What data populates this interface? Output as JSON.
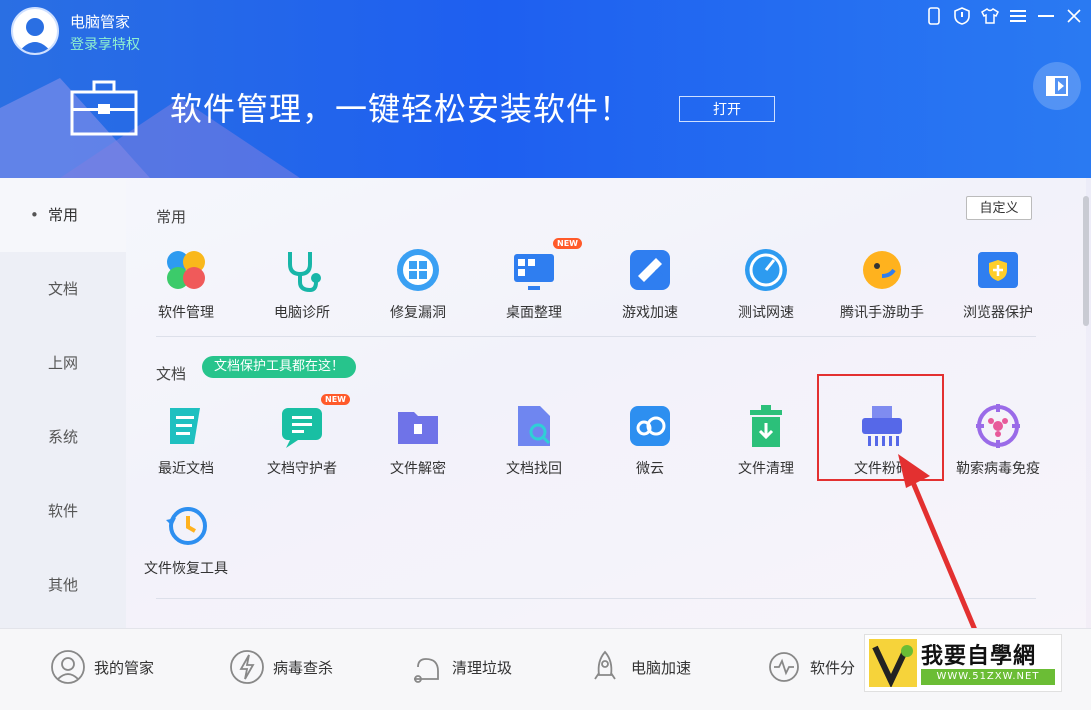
{
  "app": {
    "title": "电脑管家",
    "login_text": "登录享特权"
  },
  "banner": {
    "text": "软件管理，一键轻松安装软件！",
    "open_label": "打开"
  },
  "sidebar": {
    "items": [
      {
        "label": "常用"
      },
      {
        "label": "文档"
      },
      {
        "label": "上网"
      },
      {
        "label": "系统"
      },
      {
        "label": "软件"
      },
      {
        "label": "其他"
      }
    ]
  },
  "sections": {
    "common": {
      "title": "常用",
      "customize_label": "自定义",
      "tools": [
        {
          "label": "软件管理"
        },
        {
          "label": "电脑诊所"
        },
        {
          "label": "修复漏洞"
        },
        {
          "label": "桌面整理",
          "badge": "NEW"
        },
        {
          "label": "游戏加速"
        },
        {
          "label": "测试网速"
        },
        {
          "label": "腾讯手游助手"
        },
        {
          "label": "浏览器保护"
        }
      ]
    },
    "docs": {
      "title": "文档",
      "tip": "文档保护工具都在这！",
      "tools": [
        {
          "label": "最近文档"
        },
        {
          "label": "文档守护者",
          "badge": "NEW"
        },
        {
          "label": "文件解密"
        },
        {
          "label": "文档找回"
        },
        {
          "label": "微云"
        },
        {
          "label": "文件清理"
        },
        {
          "label": "文件粉碎"
        },
        {
          "label": "勒索病毒免疫"
        },
        {
          "label": "文件恢复工具"
        }
      ]
    }
  },
  "bottom_nav": {
    "items": [
      {
        "label": "我的管家"
      },
      {
        "label": "病毒查杀"
      },
      {
        "label": "清理垃圾"
      },
      {
        "label": "电脑加速"
      },
      {
        "label": "软件分"
      }
    ]
  },
  "watermark": {
    "title": "我要自學網",
    "url": "WWW.51ZXW.NET"
  },
  "colors": {
    "header": "#1e5ff0",
    "tip": "#27c48c",
    "highlight": "#e33030"
  }
}
